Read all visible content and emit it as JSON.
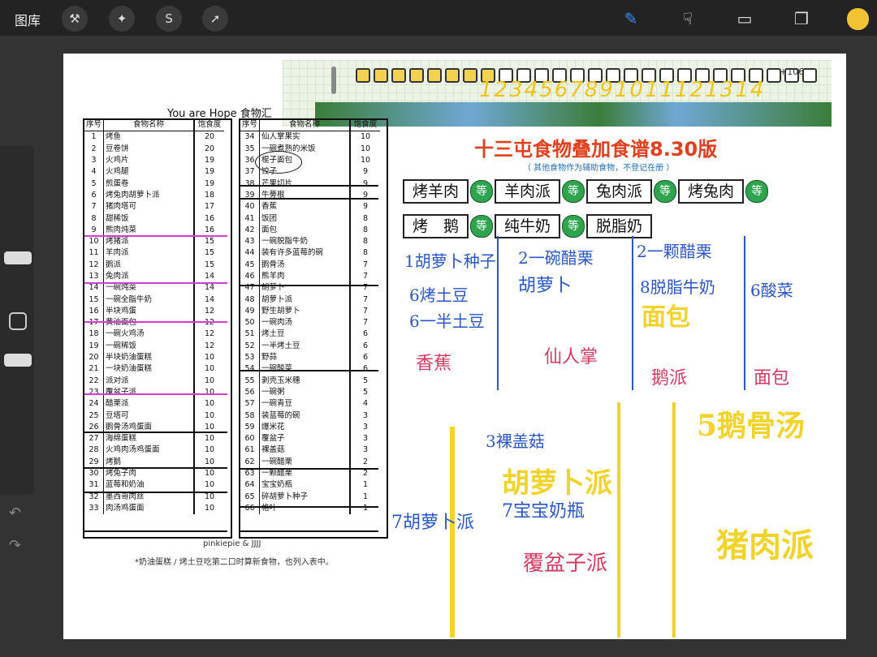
{
  "toolbar": {
    "gallery": "图库"
  },
  "game": {
    "numbers": "1234567891011121314",
    "counter": "+106"
  },
  "food_table": {
    "title": "You are Hope 食物汇",
    "headers": [
      "序号",
      "食物名称",
      "饱食度"
    ],
    "left": [
      [
        "1",
        "烤鱼",
        "20"
      ],
      [
        "2",
        "豆卷饼",
        "20"
      ],
      [
        "3",
        "火鸡片",
        "19"
      ],
      [
        "4",
        "火鸡腿",
        "19"
      ],
      [
        "5",
        "煎蛋卷",
        "19"
      ],
      [
        "6",
        "烤兔肉胡萝卜派",
        "18"
      ],
      [
        "7",
        "猪肉塔可",
        "17"
      ],
      [
        "8",
        "甜稀饭",
        "16"
      ],
      [
        "9",
        "熊肉炖菜",
        "16"
      ],
      [
        "10",
        "烤猪派",
        "15"
      ],
      [
        "11",
        "羊肉派",
        "15"
      ],
      [
        "12",
        "鹅派",
        "15"
      ],
      [
        "13",
        "兔肉派",
        "14"
      ],
      [
        "14",
        "一碗炖菜",
        "14"
      ],
      [
        "15",
        "一碗全脂牛奶",
        "14"
      ],
      [
        "16",
        "半块鸡蛋",
        "12"
      ],
      [
        "17",
        "黄油面包",
        "12"
      ],
      [
        "18",
        "一碗火鸡汤",
        "12"
      ],
      [
        "19",
        "一碗稀饭",
        "12"
      ],
      [
        "20",
        "半块奶油蛋糕",
        "10"
      ],
      [
        "21",
        "一块奶油蛋糕",
        "10"
      ],
      [
        "22",
        "派对派",
        "10"
      ],
      [
        "23",
        "覆盆子派",
        "10"
      ],
      [
        "24",
        "醋栗派",
        "10"
      ],
      [
        "25",
        "豆塔可",
        "10"
      ],
      [
        "26",
        "鹅骨汤鸡蛋面",
        "10"
      ],
      [
        "27",
        "海绵蛋糕",
        "10"
      ],
      [
        "28",
        "火鸡肉汤鸡蛋面",
        "10"
      ],
      [
        "29",
        "烤鹅",
        "10"
      ],
      [
        "30",
        "烤兔子肉",
        "10"
      ],
      [
        "31",
        "蓝莓和奶油",
        "10"
      ],
      [
        "32",
        "墨西哥肉丝",
        "10"
      ],
      [
        "33",
        "肉汤鸡蛋面",
        "10"
      ]
    ],
    "right": [
      [
        "34",
        "仙人掌果实",
        "10"
      ],
      [
        "35",
        "一碗煮熟的米饭",
        "10"
      ],
      [
        "36",
        "棍子面包",
        "10"
      ],
      [
        "37",
        "饺子",
        "9"
      ],
      [
        "38",
        "芒果切片",
        "9"
      ],
      [
        "39",
        "牛蒡根",
        "9"
      ],
      [
        "40",
        "香蕉",
        "9"
      ],
      [
        "41",
        "饭团",
        "8"
      ],
      [
        "42",
        "面包",
        "8"
      ],
      [
        "43",
        "一碗脱脂牛奶",
        "8"
      ],
      [
        "44",
        "装有许多蓝莓的碗",
        "8"
      ],
      [
        "45",
        "鹅骨汤",
        "7"
      ],
      [
        "46",
        "熊羊肉",
        "7"
      ],
      [
        "47",
        "胡萝卜",
        "7"
      ],
      [
        "48",
        "胡萝卜派",
        "7"
      ],
      [
        "49",
        "野生胡萝卜",
        "7"
      ],
      [
        "50",
        "一碗肉汤",
        "7"
      ],
      [
        "51",
        "烤土豆",
        "6"
      ],
      [
        "52",
        "一半烤土豆",
        "6"
      ],
      [
        "53",
        "野蒜",
        "6"
      ],
      [
        "54",
        "一碗酸菜",
        "6"
      ],
      [
        "55",
        "剥壳玉米穗",
        "5"
      ],
      [
        "56",
        "一碗粥",
        "5"
      ],
      [
        "57",
        "一碗青豆",
        "4"
      ],
      [
        "58",
        "装蓝莓的碗",
        "3"
      ],
      [
        "59",
        "爆米花",
        "3"
      ],
      [
        "60",
        "覆盆子",
        "3"
      ],
      [
        "61",
        "裸盖菇",
        "3"
      ],
      [
        "62",
        "一碗醋栗",
        "2"
      ],
      [
        "63",
        "一颗醋栗",
        "2"
      ],
      [
        "64",
        "宝宝奶瓶",
        "1"
      ],
      [
        "65",
        "碎胡萝卜种子",
        "1"
      ],
      [
        "66",
        "格叶",
        "1"
      ]
    ],
    "credit": "pinkiepie & JJJJ",
    "note": "*奶油蛋糕 / 烤土豆吃第二口时算新食物，也列入表中。"
  },
  "recipe": {
    "title": "十三屯食物叠加食谱8.30版",
    "subtitle": "（ 其他食物作为辅助食物，不登记在册 ）",
    "eq_label": "等",
    "row1": [
      "烤羊肉",
      "羊肉派",
      "兔肉派",
      "烤兔肉"
    ],
    "row2": [
      "烤　鹅",
      "纯牛奶",
      "脱脂奶"
    ]
  },
  "handwriting": {
    "h1": "1胡萝卜种子",
    "h2": "2一碗醋栗",
    "h3": "胡萝卜",
    "h4": "2一颗醋栗",
    "h5": "8脱脂牛奶",
    "h6": "6烤土豆",
    "h7": "6一半土豆",
    "h8": "6酸菜",
    "h9": "香蕉",
    "h10": "仙人掌",
    "h11": "鹅派",
    "h12": "面包",
    "h13": "3裸盖菇",
    "h14": "7宝宝奶瓶",
    "h15": "7胡萝卜派",
    "h16": "覆盆子派",
    "h17": "面包",
    "h18": "胡萝卜派",
    "h19": "5鹅骨汤",
    "h20": "猪肉派"
  }
}
